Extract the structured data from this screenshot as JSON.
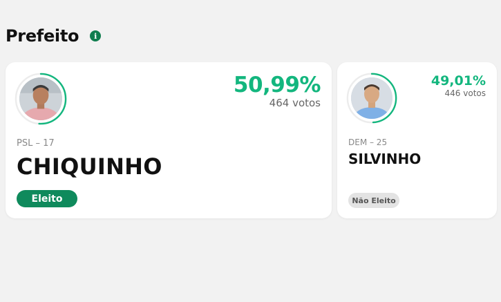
{
  "section": {
    "title": "Prefeito",
    "info_icon": "info-icon"
  },
  "colors": {
    "accent": "#13b67e",
    "elected_badge": "#0f8a5c",
    "not_elected_badge": "#e3e3e3"
  },
  "candidates": [
    {
      "percentage": "50,99%",
      "percentage_value": 0.5099,
      "votes": "464 votos",
      "party": "PSL – 17",
      "name": "CHIQUINHO",
      "status": "Eleito",
      "photo_icon": "candidate-photo"
    },
    {
      "percentage": "49,01%",
      "percentage_value": 0.4901,
      "votes": "446 votos",
      "party": "DEM – 25",
      "name": "SILVINHO",
      "status": "Não Eleito",
      "photo_icon": "candidate-photo"
    }
  ]
}
